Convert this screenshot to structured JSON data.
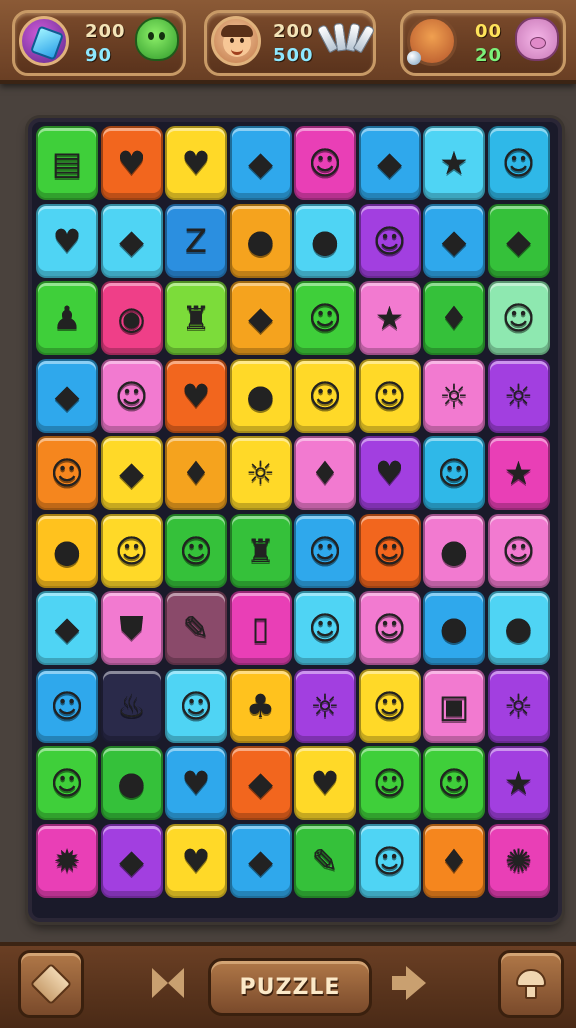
{
  "hud": {
    "panels": [
      {
        "avatar": "blue-gem-avatar",
        "top_value": "200",
        "bottom_value": "90",
        "pet": "green-blob-icon"
      },
      {
        "avatar": "boy-face-avatar",
        "top_value": "200",
        "bottom_value": "500",
        "pet": "white-shell-icon"
      },
      {
        "avatar": "orange-creature-avatar",
        "top_value": "00",
        "bottom_value": "20",
        "pet": "pink-pig-icon"
      }
    ]
  },
  "board": {
    "rows": 10,
    "cols": 8,
    "tiles": [
      {
        "color": "#3fcf3a",
        "icon": "card-icon",
        "glyph": "▤"
      },
      {
        "color": "#f2661e",
        "icon": "heart-icon",
        "glyph": "♥"
      },
      {
        "color": "#ffd928",
        "icon": "heart-icon",
        "glyph": "♥"
      },
      {
        "color": "#2fa8ec",
        "icon": "leaf-icon",
        "glyph": "◆"
      },
      {
        "color": "#e93fb6",
        "icon": "cat-face-icon",
        "glyph": "☺"
      },
      {
        "color": "#2fa8ec",
        "icon": "leaf-icon",
        "glyph": "◆"
      },
      {
        "color": "#4fd4f4",
        "icon": "star-icon",
        "glyph": "★"
      },
      {
        "color": "#2fb8e8",
        "icon": "orange-face-icon",
        "glyph": "☺"
      },
      {
        "color": "#4fd4f4",
        "icon": "heart-icon",
        "glyph": "♥"
      },
      {
        "color": "#4fd4f4",
        "icon": "leaf-icon",
        "glyph": "◆"
      },
      {
        "color": "#2b8fe0",
        "icon": "letter-z-icon",
        "glyph": "Z"
      },
      {
        "color": "#f5a31e",
        "icon": "leaf-icon",
        "glyph": "●"
      },
      {
        "color": "#4fd4f4",
        "icon": "pear-icon",
        "glyph": "●"
      },
      {
        "color": "#a23fe0",
        "icon": "ghost-icon",
        "glyph": "☺"
      },
      {
        "color": "#2fa8ec",
        "icon": "leaf-icon",
        "glyph": "◆"
      },
      {
        "color": "#35c13a",
        "icon": "leaf-icon",
        "glyph": "◆"
      },
      {
        "color": "#3fcf3a",
        "icon": "figure-icon",
        "glyph": "♟"
      },
      {
        "color": "#ef3f88",
        "icon": "candy-icon",
        "glyph": "◉"
      },
      {
        "color": "#7cdc3a",
        "icon": "bottle-icon",
        "glyph": "♜"
      },
      {
        "color": "#f5a31e",
        "icon": "leaf-icon",
        "glyph": "◆"
      },
      {
        "color": "#3fcf3a",
        "icon": "purple-face-icon",
        "glyph": "☺"
      },
      {
        "color": "#f27ad0",
        "icon": "star-icon",
        "glyph": "★"
      },
      {
        "color": "#35c13a",
        "icon": "flame-icon",
        "glyph": "♦"
      },
      {
        "color": "#8ee8b0",
        "icon": "dog-face-icon",
        "glyph": "☺"
      },
      {
        "color": "#2fa8ec",
        "icon": "leaf-icon",
        "glyph": "◆"
      },
      {
        "color": "#f27ad0",
        "icon": "apple-face-icon",
        "glyph": "☺"
      },
      {
        "color": "#f2661e",
        "icon": "heart-icon",
        "glyph": "♥"
      },
      {
        "color": "#ffd928",
        "icon": "lollipop-icon",
        "glyph": "●"
      },
      {
        "color": "#ffd928",
        "icon": "cat-face-icon",
        "glyph": "☺"
      },
      {
        "color": "#ffd928",
        "icon": "green-face-icon",
        "glyph": "☺"
      },
      {
        "color": "#f27ad0",
        "icon": "sun-face-icon",
        "glyph": "☼"
      },
      {
        "color": "#a23fe0",
        "icon": "sun-face-icon",
        "glyph": "☼"
      },
      {
        "color": "#f5861e",
        "icon": "cat-face-icon",
        "glyph": "☺"
      },
      {
        "color": "#ffd928",
        "icon": "leaf-icon",
        "glyph": "◆"
      },
      {
        "color": "#f5a31e",
        "icon": "pepper-icon",
        "glyph": "♦"
      },
      {
        "color": "#ffd928",
        "icon": "lion-icon",
        "glyph": "☼"
      },
      {
        "color": "#f27ad0",
        "icon": "drop-icon",
        "glyph": "♦"
      },
      {
        "color": "#a23fe0",
        "icon": "heart-icon",
        "glyph": "♥"
      },
      {
        "color": "#2fb8e8",
        "icon": "cat-face-icon",
        "glyph": "☺"
      },
      {
        "color": "#e93fb6",
        "icon": "star-icon",
        "glyph": "★"
      },
      {
        "color": "#ffc21e",
        "icon": "lollipop-icon",
        "glyph": "●"
      },
      {
        "color": "#ffd928",
        "icon": "orange-face-icon",
        "glyph": "☺"
      },
      {
        "color": "#35c13a",
        "icon": "lemon-icon",
        "glyph": "☺"
      },
      {
        "color": "#35c13a",
        "icon": "bottle-icon",
        "glyph": "♜"
      },
      {
        "color": "#2fa8ec",
        "icon": "purple-face-icon",
        "glyph": "☺"
      },
      {
        "color": "#f2661e",
        "icon": "bear-face-icon",
        "glyph": "☺"
      },
      {
        "color": "#f27ad0",
        "icon": "candy-icon",
        "glyph": "●"
      },
      {
        "color": "#f27ad0",
        "icon": "drop-face-icon",
        "glyph": "☺"
      },
      {
        "color": "#4fd4f4",
        "icon": "leaf-icon",
        "glyph": "◆"
      },
      {
        "color": "#f27ad0",
        "icon": "shield-icon",
        "glyph": "⛊"
      },
      {
        "color": "#8a4a6a",
        "icon": "pencil-icon",
        "glyph": "✎"
      },
      {
        "color": "#e93fb6",
        "icon": "book-icon",
        "glyph": "▯"
      },
      {
        "color": "#4fd4f4",
        "icon": "bird-face-icon",
        "glyph": "☺"
      },
      {
        "color": "#f27ad0",
        "icon": "candy-face-icon",
        "glyph": "☺"
      },
      {
        "color": "#2fa8ec",
        "icon": "grape-icon",
        "glyph": "●"
      },
      {
        "color": "#4fd4f4",
        "icon": "lemon-icon",
        "glyph": "●"
      },
      {
        "color": "#2fa8ec",
        "icon": "blue-face-icon",
        "glyph": "☺"
      },
      {
        "color": "#2a2a4a",
        "icon": "fire-icon",
        "glyph": "♨"
      },
      {
        "color": "#4fd4f4",
        "icon": "mushroom-face-icon",
        "glyph": "☺"
      },
      {
        "color": "#ffc21e",
        "icon": "leaf-figure-icon",
        "glyph": "♣"
      },
      {
        "color": "#a23fe0",
        "icon": "lion-face-icon",
        "glyph": "☼"
      },
      {
        "color": "#ffd928",
        "icon": "potato-icon",
        "glyph": "☺"
      },
      {
        "color": "#f27ad0",
        "icon": "robot-icon",
        "glyph": "▣"
      },
      {
        "color": "#a23fe0",
        "icon": "sun-face-icon",
        "glyph": "☼"
      },
      {
        "color": "#3fcf3a",
        "icon": "bird-icon",
        "glyph": "☺"
      },
      {
        "color": "#35c13a",
        "icon": "lemon-icon",
        "glyph": "●"
      },
      {
        "color": "#2fa8ec",
        "icon": "heart-icon",
        "glyph": "♥"
      },
      {
        "color": "#f2661e",
        "icon": "leaf-icon",
        "glyph": "◆"
      },
      {
        "color": "#ffd928",
        "icon": "heart-icon",
        "glyph": "♥"
      },
      {
        "color": "#3fcf3a",
        "icon": "pineapple-face-icon",
        "glyph": "☺"
      },
      {
        "color": "#3fcf3a",
        "icon": "pig-face-icon",
        "glyph": "☺"
      },
      {
        "color": "#a23fe0",
        "icon": "star-icon",
        "glyph": "★"
      },
      {
        "color": "#e93fb6",
        "icon": "starburst-icon",
        "glyph": "✹"
      },
      {
        "color": "#a23fe0",
        "icon": "leaf-icon",
        "glyph": "◆"
      },
      {
        "color": "#ffd928",
        "icon": "heart-icon",
        "glyph": "♥"
      },
      {
        "color": "#2fa8ec",
        "icon": "leaf-icon",
        "glyph": "◆"
      },
      {
        "color": "#35c13a",
        "icon": "card-icon",
        "glyph": "✎"
      },
      {
        "color": "#4fd4f4",
        "icon": "orange-face-icon",
        "glyph": "☺"
      },
      {
        "color": "#f5861e",
        "icon": "blue-bird-icon",
        "glyph": "♦"
      },
      {
        "color": "#e93fb6",
        "icon": "sun-icon",
        "glyph": "✺"
      }
    ]
  },
  "bottom_bar": {
    "left_button": "diamond-icon",
    "prev_button": "previous-arrow-icon",
    "center_label": "PUZZLE",
    "next_button": "next-arrow-icon",
    "right_button": "mushroom-icon"
  }
}
